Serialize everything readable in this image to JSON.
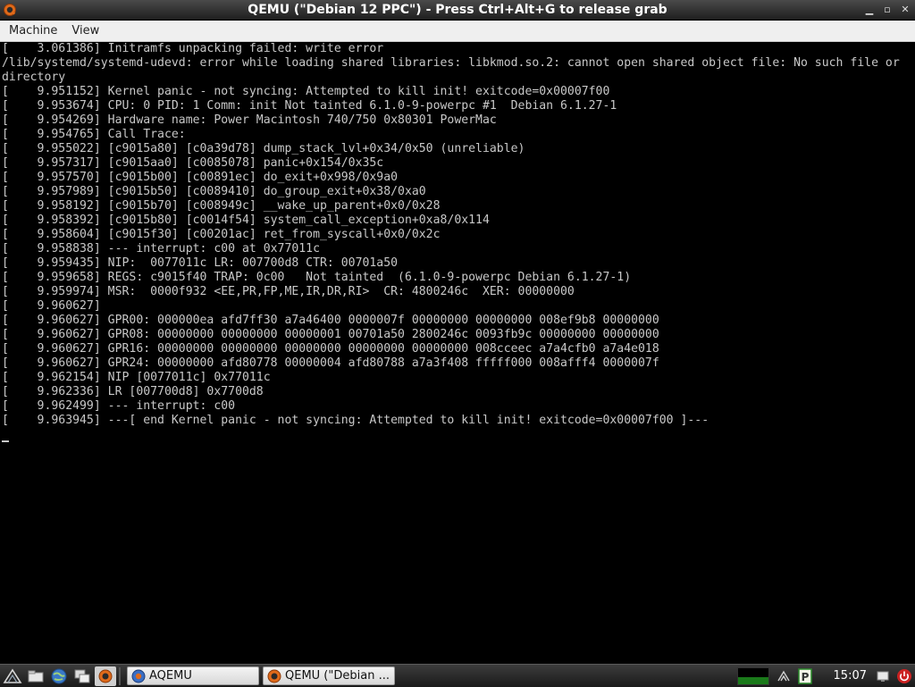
{
  "window": {
    "title": "QEMU (\"Debian 12 PPC\") - Press Ctrl+Alt+G to release grab",
    "controls": [
      "minimize-icon",
      "maximize-icon",
      "close-icon"
    ]
  },
  "menu": {
    "items": [
      "Machine",
      "View"
    ]
  },
  "console": {
    "lines": [
      "[    3.061386] Initramfs unpacking failed: write error",
      "/lib/systemd/systemd-udevd: error while loading shared libraries: libkmod.so.2: cannot open shared object file: No such file or",
      "directory",
      "[    9.951152] Kernel panic - not syncing: Attempted to kill init! exitcode=0x00007f00",
      "[    9.953674] CPU: 0 PID: 1 Comm: init Not tainted 6.1.0-9-powerpc #1  Debian 6.1.27-1",
      "[    9.954269] Hardware name: Power Macintosh 740/750 0x80301 PowerMac",
      "[    9.954765] Call Trace:",
      "[    9.955022] [c9015a80] [c0a39d78] dump_stack_lvl+0x34/0x50 (unreliable)",
      "[    9.957317] [c9015aa0] [c0085078] panic+0x154/0x35c",
      "[    9.957570] [c9015b00] [c00891ec] do_exit+0x998/0x9a0",
      "[    9.957989] [c9015b50] [c0089410] do_group_exit+0x38/0xa0",
      "[    9.958192] [c9015b70] [c008949c] __wake_up_parent+0x0/0x28",
      "[    9.958392] [c9015b80] [c0014f54] system_call_exception+0xa8/0x114",
      "[    9.958604] [c9015f30] [c00201ac] ret_from_syscall+0x0/0x2c",
      "[    9.958838] --- interrupt: c00 at 0x77011c",
      "[    9.959435] NIP:  0077011c LR: 007700d8 CTR: 00701a50",
      "[    9.959658] REGS: c9015f40 TRAP: 0c00   Not tainted  (6.1.0-9-powerpc Debian 6.1.27-1)",
      "[    9.959974] MSR:  0000f932 <EE,PR,FP,ME,IR,DR,RI>  CR: 4800246c  XER: 00000000",
      "[    9.960627]",
      "[    9.960627] GPR00: 000000ea afd7ff30 a7a46400 0000007f 00000000 00000000 008ef9b8 00000000",
      "[    9.960627] GPR08: 00000000 00000000 00000001 00701a50 2800246c 0093fb9c 00000000 00000000",
      "[    9.960627] GPR16: 00000000 00000000 00000000 00000000 00000000 008cceec a7a4cfb0 a7a4e018",
      "[    9.960627] GPR24: 00000000 afd80778 00000004 afd80788 a7a3f408 fffff000 008afff4 0000007f",
      "[    9.962154] NIP [0077011c] 0x77011c",
      "[    9.962336] LR [007700d8] 0x7700d8",
      "[    9.962499] --- interrupt: c00",
      "[    9.963945] ---[ end Kernel panic - not syncing: Attempted to kill init! exitcode=0x00007f00 ]---"
    ]
  },
  "taskbar": {
    "launchers": [
      "start-menu-icon",
      "file-manager-icon",
      "web-browser-icon",
      "show-desktop-icon",
      "qemu-launcher-icon"
    ],
    "tasks": [
      {
        "label": "AQEMU",
        "icon": "aqemu-icon"
      },
      {
        "label": "QEMU (\"Debian ...",
        "icon": "qemu-icon"
      }
    ],
    "cpu_usage_fraction": 0.4,
    "clock": "15:07",
    "tray_icons": [
      "pidgin-icon",
      "network-icon",
      "power-icon"
    ],
    "colors": {
      "cpu_fill": "#1a7a1a",
      "power_icon": "#cc2222"
    }
  }
}
